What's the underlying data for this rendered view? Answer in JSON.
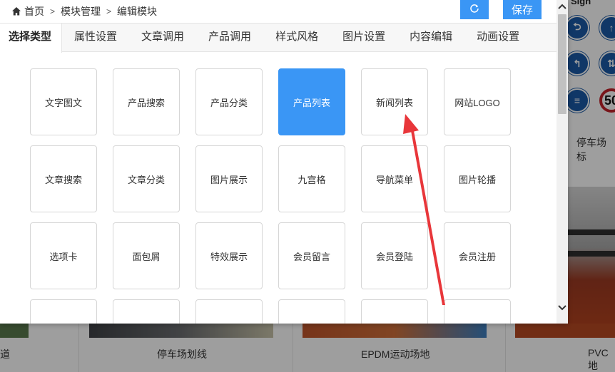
{
  "breadcrumb": {
    "home": "首页",
    "sep": ">",
    "module_manage": "模块管理",
    "edit_module": "编辑模块"
  },
  "toolbar": {
    "refresh_icon": "refresh-icon",
    "save_label": "保存"
  },
  "tabs": [
    {
      "label": "选择类型",
      "active": true
    },
    {
      "label": "属性设置"
    },
    {
      "label": "文章调用"
    },
    {
      "label": "产品调用"
    },
    {
      "label": "样式风格"
    },
    {
      "label": "图片设置"
    },
    {
      "label": "内容编辑"
    },
    {
      "label": "动画设置"
    }
  ],
  "module_types": [
    [
      "文字图文",
      "产品搜索",
      "产品分类",
      "产品列表",
      "新闻列表",
      "网站LOGO"
    ],
    [
      "文章搜索",
      "文章分类",
      "图片展示",
      "九宫格",
      "导航菜单",
      "图片轮播"
    ],
    [
      "选项卡",
      "面包屑",
      "特效展示",
      "会员留言",
      "会员登陆",
      "会员注册"
    ],
    [
      "",
      "",
      "",
      "",
      "",
      ""
    ]
  ],
  "selected_type": "产品列表",
  "colors": {
    "accent": "#3a96f5",
    "arrow": "#e8363a",
    "tile_border": "#d6d6d6"
  },
  "background": {
    "sign_title": "Sign",
    "sign_speed": "50",
    "parking_label_right": "停车场标",
    "cards": [
      {
        "label": "道"
      },
      {
        "label": "停车场划线"
      },
      {
        "label": "EPDM运动场地"
      },
      {
        "label": "PVC地"
      }
    ]
  }
}
